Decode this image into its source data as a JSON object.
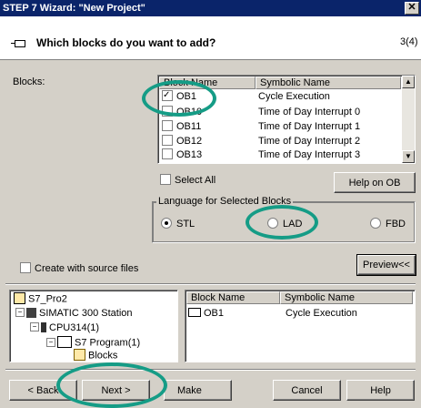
{
  "window": {
    "title": "STEP 7 Wizard: \"New Project\"",
    "close_glyph": "✕"
  },
  "header": {
    "question": "Which blocks do you want to add?",
    "page": "3(4)"
  },
  "blocks": {
    "label": "Blocks:",
    "columns": [
      "Block Name",
      "Symbolic Name"
    ],
    "rows": [
      {
        "name": "OB1",
        "symbolic": "Cycle Execution",
        "checked": true
      },
      {
        "name": "OB10",
        "symbolic": "Time of Day Interrupt 0",
        "checked": false
      },
      {
        "name": "OB11",
        "symbolic": "Time of Day Interrupt 1",
        "checked": false
      },
      {
        "name": "OB12",
        "symbolic": "Time of Day Interrupt 2",
        "checked": false
      },
      {
        "name": "OB13",
        "symbolic": "Time of Day Interrupt 3",
        "checked": false
      }
    ]
  },
  "select_all": "Select All",
  "help_on_ob": "Help on OB",
  "language": {
    "label": "Language for Selected Blocks",
    "options": [
      "STL",
      "LAD",
      "FBD"
    ],
    "selected": "STL"
  },
  "create_source": "Create with source files",
  "preview_btn": "Preview<<",
  "tree": {
    "items": [
      "S7_Pro2",
      "SIMATIC 300 Station",
      "CPU314(1)",
      "S7 Program(1)",
      "Blocks"
    ]
  },
  "preview_list": {
    "columns": [
      "Block Name",
      "Symbolic Name"
    ],
    "rows": [
      {
        "name": "OB1",
        "symbolic": "Cycle Execution"
      }
    ]
  },
  "buttons": {
    "back": "< Back",
    "next": "Next >",
    "make": "Make",
    "cancel": "Cancel",
    "help": "Help"
  },
  "colors": {
    "titlebar": "#0a246a",
    "face": "#d4d0c8",
    "highlight_circle": "#159c86"
  }
}
